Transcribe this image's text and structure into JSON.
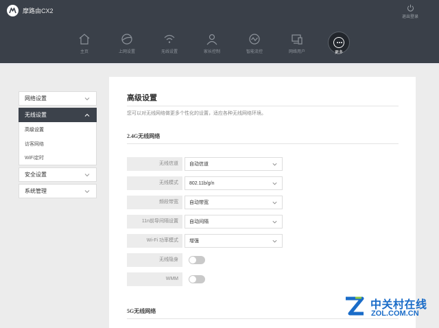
{
  "app": {
    "title": "摩路由CX2"
  },
  "logout": {
    "label": "退出登录"
  },
  "nav": {
    "items": [
      {
        "label": "主页",
        "icon": "home-icon"
      },
      {
        "label": "上网设置",
        "icon": "globe-icon"
      },
      {
        "label": "无线设置",
        "icon": "wifi-icon"
      },
      {
        "label": "家长控制",
        "icon": "user-icon"
      },
      {
        "label": "智能流控",
        "icon": "flow-icon"
      },
      {
        "label": "网络用户",
        "icon": "devices-icon"
      },
      {
        "label": "更多",
        "icon": "more-icon",
        "active": true
      }
    ]
  },
  "sidebar": {
    "groups": [
      {
        "label": "网络设置"
      },
      {
        "label": "无线设置",
        "active": true,
        "children": [
          "高级设置",
          "访客网络",
          "WiFi定时"
        ]
      },
      {
        "label": "安全设置"
      },
      {
        "label": "系统管理"
      }
    ]
  },
  "main": {
    "title": "高级设置",
    "description": "您可以对无线网络做更多个性化的设置，适应各种无线网络环境。",
    "section_24g": "2.4G无线网络",
    "section_5g": "5G无线网络",
    "fields": [
      {
        "label": "无线信道",
        "value": "自动信道",
        "type": "select"
      },
      {
        "label": "无线模式",
        "value": "802.11b/g/n",
        "type": "select"
      },
      {
        "label": "频段带宽",
        "value": "自动带宽",
        "type": "select"
      },
      {
        "label": "11n前导间隔设置",
        "value": "自动间隔",
        "type": "select"
      },
      {
        "label": "Wi-Fi 功率模式",
        "value": "增强",
        "type": "select"
      },
      {
        "label": "无线隐身",
        "value": "off",
        "type": "toggle"
      },
      {
        "label": "WMM",
        "value": "off",
        "type": "toggle"
      }
    ]
  },
  "watermark": {
    "cn": "中关村在线",
    "en": "ZOL.COM.CN"
  },
  "colors": {
    "header_bg": "#3a4049",
    "sidebar_active": "#3c424b",
    "brand_blue": "#1a6cc8",
    "page_bg": "#ececec"
  }
}
